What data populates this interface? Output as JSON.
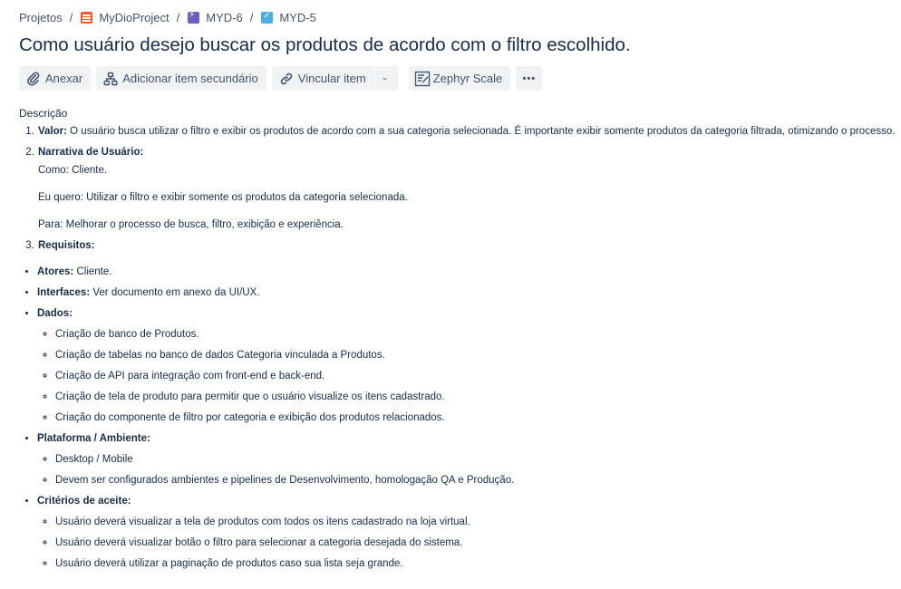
{
  "breadcrumb": {
    "items": [
      "Projetos",
      "MyDioProject",
      "MYD-6",
      "MYD-5"
    ],
    "separator": "/"
  },
  "issue": {
    "title": "Como usuário desejo buscar os produtos de acordo com o filtro escolhido."
  },
  "toolbar": {
    "attach_label": "Anexar",
    "add_child_label": "Adicionar item secundário",
    "link_label": "Vincular item",
    "zephyr_label": "Zephyr Scale",
    "more_label": "•••"
  },
  "description": {
    "label": "Descrição",
    "items": [
      {
        "heading": "Valor:",
        "text": " O usuário busca utilizar o filtro e exibir os produtos de acordo com a sua categoria selecionada.  É importante exibir somente produtos da categoria filtrada, otimizando o processo."
      },
      {
        "heading": "Narrativa de Usuário:",
        "lines": [
          "Como: Cliente.",
          "Eu quero: Utilizar o filtro e exibir somente os produtos da categoria selecionada.",
          "Para: Melhorar o processo de busca, filtro, exibição e experiência."
        ]
      },
      {
        "heading": "Requisitos:"
      }
    ],
    "bullets": [
      {
        "heading": "Atores:",
        "text": " Cliente."
      },
      {
        "heading": "Interfaces:",
        "text": " Ver documento em anexo da UI/UX."
      },
      {
        "heading": "Dados:",
        "sub": [
          "Criação de banco de Produtos.",
          "Criação de tabelas no banco de dados Categoria vinculada a Produtos.",
          "Criação de API para integração com front-end e back-end.",
          "Criação de tela de produto para permitir que o usuário visualize os itens cadastrado.",
          "Criação do componente de filtro por categoria e exibição dos produtos relacionados."
        ]
      },
      {
        "heading": "Plataforma / Ambiente:",
        "sub": [
          "Desktop / Mobile",
          "Devem ser configurados ambientes e pipelines de Desenvolvimento, homologação QA e Produção."
        ]
      },
      {
        "heading": "Critérios de aceite:",
        "sub": [
          "Usuário deverá visualizar a tela de produtos com todos os itens cadastrado na loja virtual.",
          "Usuário deverá visualizar botão o filtro para selecionar a categoria desejada do sistema.",
          "Usuário deverá utilizar a paginação de produtos caso sua lista seja grande."
        ]
      }
    ]
  }
}
